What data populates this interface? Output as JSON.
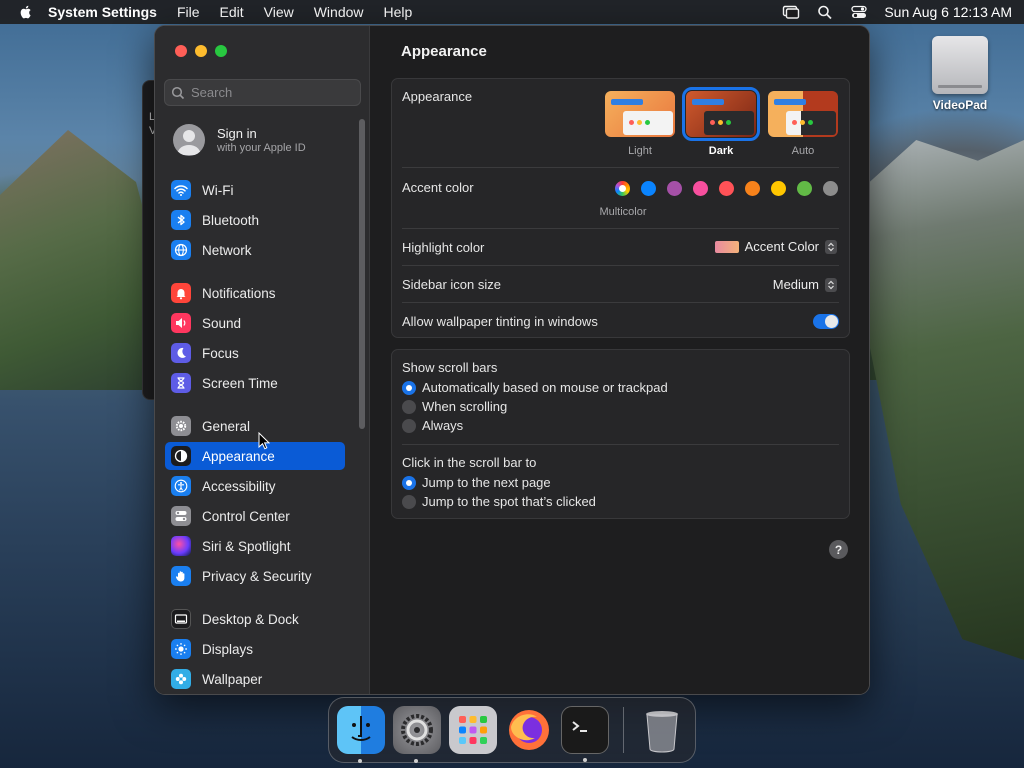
{
  "menubar": {
    "app_name": "System Settings",
    "menus": [
      "File",
      "Edit",
      "View",
      "Window",
      "Help"
    ],
    "clock": "Sun Aug 6  12:13 AM"
  },
  "background_window": {
    "lines": [
      "L",
      "V"
    ]
  },
  "window": {
    "search_placeholder": "Search",
    "account": {
      "title": "Sign in",
      "subtitle": "with your Apple ID"
    },
    "sidebar_items": [
      {
        "label": "Wi-Fi",
        "icon": "wifi-icon",
        "color": "#1a7ff0"
      },
      {
        "label": "Bluetooth",
        "icon": "bluetooth-icon",
        "color": "#1a7ff0"
      },
      {
        "label": "Network",
        "icon": "globe-icon",
        "color": "#1a7ff0"
      },
      {
        "label": "Notifications",
        "icon": "bell-icon",
        "color": "#ff453a"
      },
      {
        "label": "Sound",
        "icon": "speaker-icon",
        "color": "#ff375f"
      },
      {
        "label": "Focus",
        "icon": "moon-icon",
        "color": "#5e5ce6"
      },
      {
        "label": "Screen Time",
        "icon": "hourglass-icon",
        "color": "#5e5ce6"
      },
      {
        "label": "General",
        "icon": "gear-icon",
        "color": "#8e8e93"
      },
      {
        "label": "Appearance",
        "icon": "appearance-icon",
        "color": "#1c1c1e",
        "active": true
      },
      {
        "label": "Accessibility",
        "icon": "accessibility-icon",
        "color": "#1a7ff0"
      },
      {
        "label": "Control Center",
        "icon": "control-center-icon",
        "color": "#8e8e93"
      },
      {
        "label": "Siri & Spotlight",
        "icon": "siri-icon",
        "color": "#bf5af2"
      },
      {
        "label": "Privacy & Security",
        "icon": "hand-icon",
        "color": "#1a7ff0"
      },
      {
        "label": "Desktop & Dock",
        "icon": "dock-icon",
        "color": "#1c1c1e"
      },
      {
        "label": "Displays",
        "icon": "sun-icon",
        "color": "#1a7ff0"
      },
      {
        "label": "Wallpaper",
        "icon": "flower-icon",
        "color": "#32ade6"
      }
    ]
  },
  "content": {
    "title": "Appearance",
    "appearance_label": "Appearance",
    "themes": [
      {
        "label": "Light"
      },
      {
        "label": "Dark",
        "selected": true
      },
      {
        "label": "Auto"
      }
    ],
    "accent_label": "Accent color",
    "accent_caption": "Multicolor",
    "accent_colors": [
      "multicolor",
      "#0a84ff",
      "#a550a7",
      "#f74f9e",
      "#ff5257",
      "#f7821b",
      "#ffc600",
      "#62ba46",
      "#8c8c8c"
    ],
    "highlight_label": "Highlight color",
    "highlight_value": "Accent Color",
    "icon_size_label": "Sidebar icon size",
    "icon_size_value": "Medium",
    "tinting_label": "Allow wallpaper tinting in windows",
    "tinting_on": true,
    "scrollbars_label": "Show scroll bars",
    "scrollbar_options": [
      "Automatically based on mouse or trackpad",
      "When scrolling",
      "Always"
    ],
    "scrollbar_selected": 0,
    "click_label": "Click in the scroll bar to",
    "click_options": [
      "Jump to the next page",
      "Jump to the spot that’s clicked"
    ],
    "click_selected": 0,
    "help": "?"
  },
  "desktop": {
    "icon_label": "VideoPad"
  },
  "dock": {
    "apps": [
      {
        "name": "finder-icon",
        "running": true
      },
      {
        "name": "system-settings-icon",
        "running": true
      },
      {
        "name": "launchpad-icon",
        "running": false
      },
      {
        "name": "firefox-icon",
        "running": false
      },
      {
        "name": "terminal-icon",
        "running": true
      }
    ],
    "trash": "trash-icon"
  }
}
